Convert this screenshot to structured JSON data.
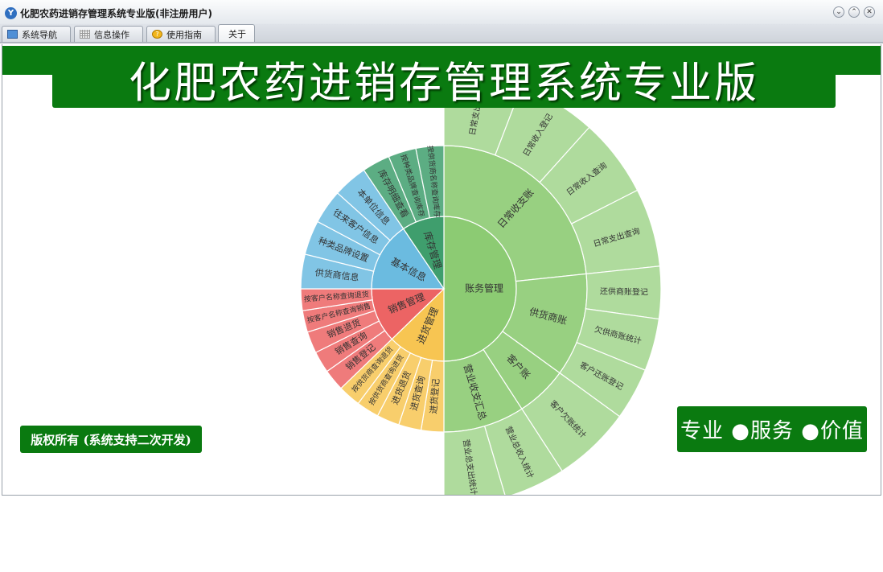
{
  "window": {
    "title": "化肥农药进销存管理系统专业版(非注册用户)",
    "app_icon": "app-logo-icon",
    "buttons": [
      "minimize-icon",
      "maximize-icon",
      "close-icon"
    ]
  },
  "tabs": [
    {
      "label": "系统导航",
      "icon": "monitor-icon",
      "active": false
    },
    {
      "label": "信息操作",
      "icon": "grid-icon",
      "active": false
    },
    {
      "label": "使用指南",
      "icon": "coin-icon",
      "active": false
    },
    {
      "label": "关于",
      "icon": "",
      "active": true
    }
  ],
  "banner": {
    "title": "化肥农药进销存管理系统专业版"
  },
  "copyright": "版权所有 (系统支持二次开发)",
  "slogan": "专业 ●服务 ●价值",
  "colors": {
    "brand_green": "#0a7a10",
    "account": "#8ccb73",
    "stock": "#3f9e6d",
    "basic": "#6bbbe0",
    "sales": "#ec6464",
    "purchase": "#f7c552"
  },
  "sunburst": {
    "inner": [
      {
        "label": "账务管理",
        "color": "#8ccb73",
        "children": [
          {
            "label": "日常收支账",
            "children": [
              "日常支出登记",
              "日常收入登记",
              "日常收入查询",
              "日常支出查询"
            ]
          },
          {
            "label": "供货商账",
            "children": [
              "还供商账登记",
              "欠供商账统计",
              "客户还账登记"
            ]
          },
          {
            "label": "客户账",
            "children": [
              "客户欠账统计"
            ]
          },
          {
            "label": "营业收支汇总",
            "children": [
              "营业总收入统计",
              "营业总支出统计"
            ]
          }
        ]
      },
      {
        "label": "进货管理",
        "color": "#f7c552",
        "children": [
          "进货登记",
          "进货查询",
          "进货退货",
          "按供货商查询进货",
          "按供货商查询退货"
        ]
      },
      {
        "label": "销售管理",
        "color": "#ec6464",
        "children": [
          "销售登记",
          "销售查询",
          "销售退货",
          "按客户名称查询销售",
          "按客户名称查询退货"
        ]
      },
      {
        "label": "基本信息",
        "color": "#6bbbe0",
        "children": [
          "供货商信息",
          "种类品牌设置",
          "往来客户信息",
          "本单位信息"
        ]
      },
      {
        "label": "库存管理",
        "color": "#3f9e6d",
        "children": [
          "库存明细查看",
          "按种类品牌查询库存",
          "按供货商名称查询库存"
        ]
      }
    ]
  }
}
